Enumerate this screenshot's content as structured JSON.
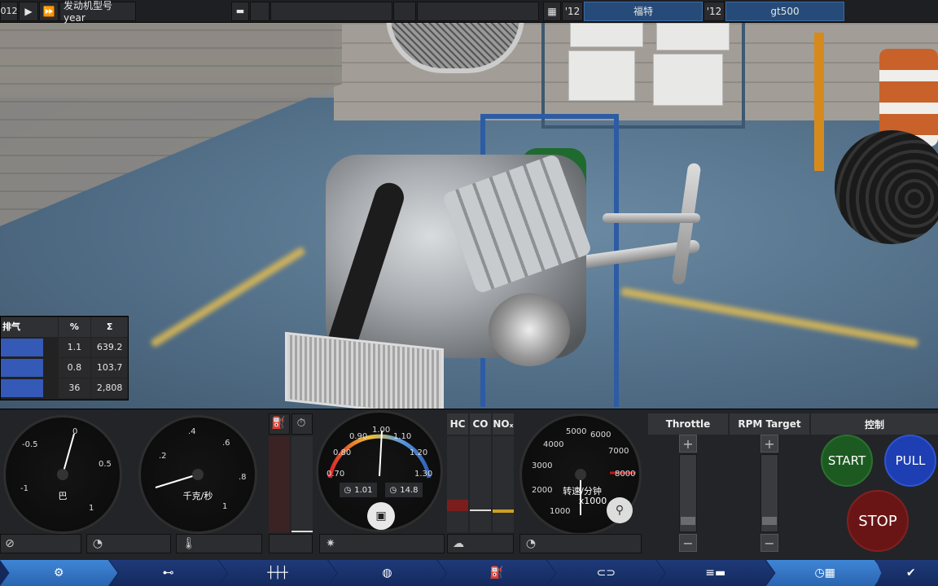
{
  "topbar": {
    "year_cell": "012",
    "model_label": "发动机型号 year",
    "year_a": "'12",
    "make": "福特",
    "year_b": "'12",
    "model": "gt500"
  },
  "stats": {
    "header": "排气",
    "col_pct": "%",
    "col_sum": "Σ",
    "rows": [
      {
        "pct": "1.1",
        "sum": "639.2"
      },
      {
        "pct": "0.8",
        "sum": "103.7"
      },
      {
        "pct": "36",
        "sum": "2,808"
      }
    ]
  },
  "gauges": {
    "boost": {
      "unit": "巴",
      "ticks": [
        "-0.5",
        "0",
        "0.5",
        "-1",
        "1"
      ]
    },
    "flow": {
      "unit": "千克/秒",
      "ticks": [
        ".2",
        ".4",
        ".6",
        ".8",
        "1"
      ]
    },
    "lambda": {
      "ticks": [
        "0.70",
        "0.80",
        "0.90",
        "1.00",
        "1.10",
        "1.20",
        "1.30"
      ],
      "readout_a": "1.01",
      "readout_b": "14.8"
    },
    "emissions": {
      "hc": "HC",
      "co": "CO",
      "nox": "NOₓ"
    },
    "rpm": {
      "unit": "转速/分钟",
      "mult": "x1000",
      "ticks": [
        "1000",
        "2000",
        "3000",
        "4000",
        "5000",
        "6000",
        "7000",
        "8000"
      ]
    }
  },
  "controls": {
    "throttle": "Throttle",
    "rpm_target": "RPM Target",
    "control": "控制",
    "plus": "+",
    "minus": "−",
    "start": "START",
    "pull": "PULL",
    "stop": "STOP"
  },
  "nav": {
    "tabs": [
      "engine-cylinder-icon",
      "crankshaft-icon",
      "camshaft-icon",
      "turbo-icon",
      "fuel-pump-icon",
      "exhaust-icon",
      "ecu-icon",
      "dyno-icon"
    ],
    "confirm": "✔"
  },
  "colors": {
    "accent_blue": "#3459b6",
    "start_green": "#1d5a22",
    "pull_blue": "#1e3fb3",
    "stop_red": "#6a1515",
    "redline": "#c01818"
  }
}
